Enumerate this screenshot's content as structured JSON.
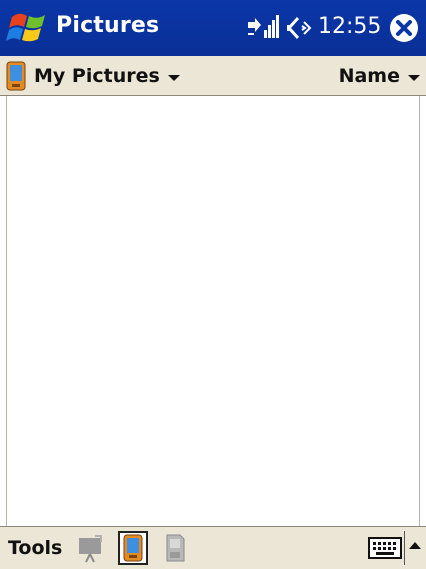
{
  "title_bar": {
    "app_title": "Pictures",
    "clock": "12:55",
    "colors": {
      "background": "#0a36a8",
      "text": "#ffffff"
    }
  },
  "nav_bar": {
    "folder": "My Pictures",
    "sort": "Name"
  },
  "content": {
    "items": []
  },
  "menu_bar": {
    "tools_label": "Tools",
    "buttons": [
      "slideshow-button",
      "camera-button",
      "storage-card-button"
    ],
    "selected": "camera-button"
  },
  "icons": {
    "start": "windows-flag-icon",
    "connectivity": "connectivity-icon",
    "volume": "speaker-icon",
    "close": "close-icon",
    "folder": "pocketpc-device-icon",
    "keyboard": "keyboard-icon",
    "sip": "chevron-up-icon"
  }
}
